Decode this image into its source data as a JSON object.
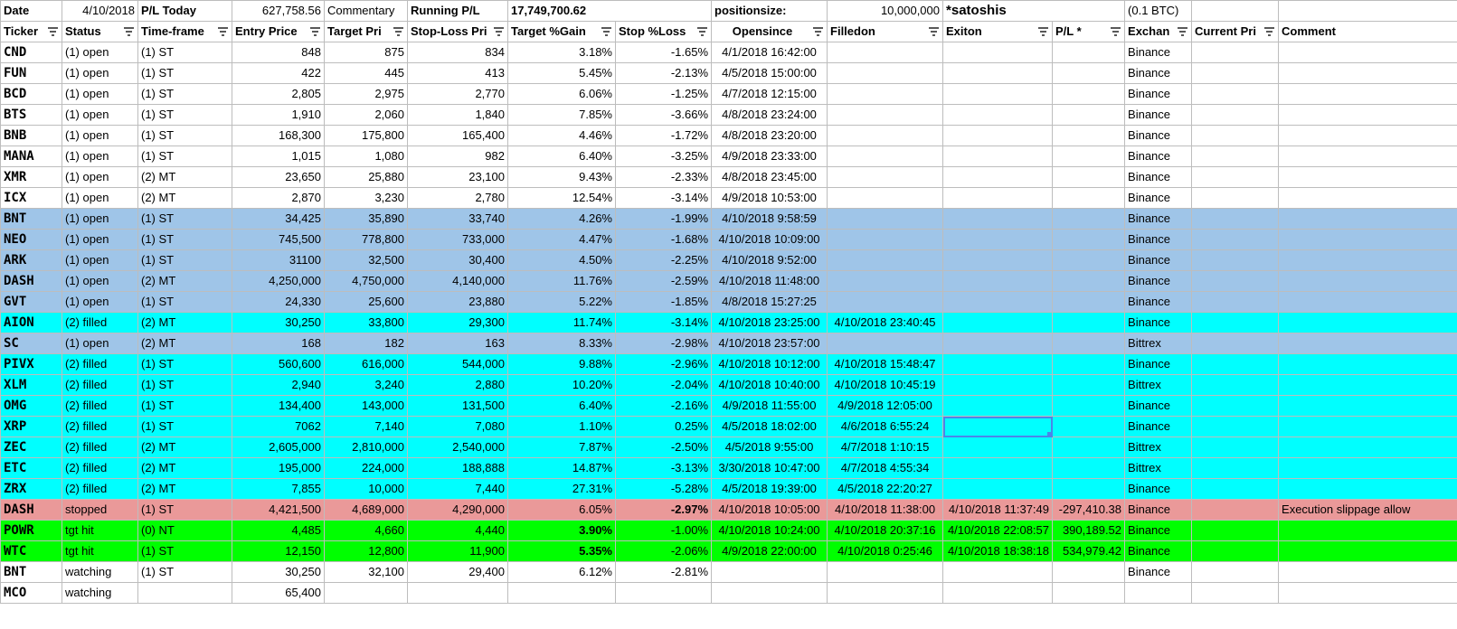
{
  "top_row": {
    "date_label": "Date",
    "date_value": "4/10/2018",
    "pl_today_label": "P/L Today",
    "pl_today_value": "627,758.56",
    "commentary_label": "Commentary",
    "running_pl_label": "Running P/L",
    "running_pl_value": "17,749,700.62",
    "positionsize_label": "positionsize:",
    "positionsize_value": "10,000,000",
    "satoshis_label": "*satoshis",
    "btc_note": "(0.1 BTC)"
  },
  "headers": [
    "Ticker",
    "Status",
    "Time-frame",
    "Entry Price",
    "Target Pri",
    "Stop-Loss Pri",
    "Target %Gain",
    "Stop %Loss",
    "Opensince",
    "Filledon",
    "Exiton",
    "P/L *",
    "Exchan",
    "Current Pri",
    "Comment"
  ],
  "row_colors": {
    "none": "#ffffff",
    "blue": "#9fc5e8",
    "cyan": "#00ffff",
    "red": "#ea9999",
    "green": "#00ff00",
    "selection": "#4a86e8"
  },
  "rows": [
    {
      "color": "none",
      "cells": [
        "CND",
        "(1) open",
        "(1) ST",
        "848",
        "875",
        "834",
        "3.18%",
        "-1.65%",
        "4/1/2018 16:42:00",
        "",
        "",
        "",
        "Binance",
        "",
        ""
      ]
    },
    {
      "color": "none",
      "cells": [
        "FUN",
        "(1) open",
        "(1) ST",
        "422",
        "445",
        "413",
        "5.45%",
        "-2.13%",
        "4/5/2018 15:00:00",
        "",
        "",
        "",
        "Binance",
        "",
        ""
      ]
    },
    {
      "color": "none",
      "cells": [
        "BCD",
        "(1) open",
        "(1) ST",
        "2,805",
        "2,975",
        "2,770",
        "6.06%",
        "-1.25%",
        "4/7/2018 12:15:00",
        "",
        "",
        "",
        "Binance",
        "",
        ""
      ]
    },
    {
      "color": "none",
      "cells": [
        "BTS",
        "(1) open",
        "(1) ST",
        "1,910",
        "2,060",
        "1,840",
        "7.85%",
        "-3.66%",
        "4/8/2018 23:24:00",
        "",
        "",
        "",
        "Binance",
        "",
        ""
      ]
    },
    {
      "color": "none",
      "cells": [
        "BNB",
        "(1) open",
        "(1) ST",
        "168,300",
        "175,800",
        "165,400",
        "4.46%",
        "-1.72%",
        "4/8/2018 23:20:00",
        "",
        "",
        "",
        "Binance",
        "",
        ""
      ]
    },
    {
      "color": "none",
      "cells": [
        "MANA",
        "(1) open",
        "(1) ST",
        "1,015",
        "1,080",
        "982",
        "6.40%",
        "-3.25%",
        "4/9/2018 23:33:00",
        "",
        "",
        "",
        "Binance",
        "",
        ""
      ]
    },
    {
      "color": "none",
      "cells": [
        "XMR",
        "(1) open",
        "(2) MT",
        "23,650",
        "25,880",
        "23,100",
        "9.43%",
        "-2.33%",
        "4/8/2018 23:45:00",
        "",
        "",
        "",
        "Binance",
        "",
        ""
      ]
    },
    {
      "color": "none",
      "cells": [
        "ICX",
        "(1) open",
        "(2) MT",
        "2,870",
        "3,230",
        "2,780",
        "12.54%",
        "-3.14%",
        "4/9/2018 10:53:00",
        "",
        "",
        "",
        "Binance",
        "",
        ""
      ]
    },
    {
      "color": "blue",
      "cells": [
        "BNT",
        "(1) open",
        "(1) ST",
        "34,425",
        "35,890",
        "33,740",
        "4.26%",
        "-1.99%",
        "4/10/2018 9:58:59",
        "",
        "",
        "",
        "Binance",
        "",
        ""
      ]
    },
    {
      "color": "blue",
      "cells": [
        "NEO",
        "(1) open",
        "(1) ST",
        "745,500",
        "778,800",
        "733,000",
        "4.47%",
        "-1.68%",
        "4/10/2018 10:09:00",
        "",
        "",
        "",
        "Binance",
        "",
        ""
      ]
    },
    {
      "color": "blue",
      "cells": [
        "ARK",
        "(1) open",
        "(1) ST",
        "31100",
        "32,500",
        "30,400",
        "4.50%",
        "-2.25%",
        "4/10/2018 9:52:00",
        "",
        "",
        "",
        "Binance",
        "",
        ""
      ]
    },
    {
      "color": "blue",
      "cells": [
        "DASH",
        "(1) open",
        "(2) MT",
        "4,250,000",
        "4,750,000",
        "4,140,000",
        "11.76%",
        "-2.59%",
        "4/10/2018 11:48:00",
        "",
        "",
        "",
        "Binance",
        "",
        ""
      ]
    },
    {
      "color": "blue",
      "cells": [
        "GVT",
        "(1) open",
        "(1) ST",
        "24,330",
        "25,600",
        "23,880",
        "5.22%",
        "-1.85%",
        "4/8/2018 15:27:25",
        "",
        "",
        "",
        "Binance",
        "",
        ""
      ]
    },
    {
      "color": "cyan",
      "cells": [
        "AION",
        "(2) filled",
        "(2) MT",
        "30,250",
        "33,800",
        "29,300",
        "11.74%",
        "-3.14%",
        "4/10/2018 23:25:00",
        "4/10/2018 23:40:45",
        "",
        "",
        "Binance",
        "",
        ""
      ]
    },
    {
      "color": "blue",
      "cells": [
        "SC",
        "(1) open",
        "(2) MT",
        "168",
        "182",
        "163",
        "8.33%",
        "-2.98%",
        "4/10/2018 23:57:00",
        "",
        "",
        "",
        "Bittrex",
        "",
        ""
      ]
    },
    {
      "color": "cyan",
      "cells": [
        "PIVX",
        "(2) filled",
        "(1) ST",
        "560,600",
        "616,000",
        "544,000",
        "9.88%",
        "-2.96%",
        "4/10/2018 10:12:00",
        "4/10/2018 15:48:47",
        "",
        "",
        "Binance",
        "",
        ""
      ]
    },
    {
      "color": "cyan",
      "cells": [
        "XLM",
        "(2) filled",
        "(1) ST",
        "2,940",
        "3,240",
        "2,880",
        "10.20%",
        "-2.04%",
        "4/10/2018 10:40:00",
        "4/10/2018 10:45:19",
        "",
        "",
        "Bittrex",
        "",
        ""
      ]
    },
    {
      "color": "cyan",
      "cells": [
        "OMG",
        "(2) filled",
        "(1) ST",
        "134,400",
        "143,000",
        "131,500",
        "6.40%",
        "-2.16%",
        "4/9/2018 11:55:00",
        "4/9/2018 12:05:00",
        "",
        "",
        "Binance",
        "",
        ""
      ]
    },
    {
      "color": "cyan",
      "cells": [
        "XRP",
        "(2) filled",
        "(1) ST",
        "7062",
        "7,140",
        "7,080",
        "1.10%",
        "0.25%",
        "4/5/2018 18:02:00",
        "4/6/2018 6:55:24",
        "",
        "",
        "Binance",
        "",
        ""
      ]
    },
    {
      "color": "cyan",
      "cells": [
        "ZEC",
        "(2) filled",
        "(2) MT",
        "2,605,000",
        "2,810,000",
        "2,540,000",
        "7.87%",
        "-2.50%",
        "4/5/2018 9:55:00",
        "4/7/2018 1:10:15",
        "",
        "",
        "Bittrex",
        "",
        ""
      ]
    },
    {
      "color": "cyan",
      "cells": [
        "ETC",
        "(2) filled",
        "(2) MT",
        "195,000",
        "224,000",
        "188,888",
        "14.87%",
        "-3.13%",
        "3/30/2018 10:47:00",
        "4/7/2018 4:55:34",
        "",
        "",
        "Bittrex",
        "",
        ""
      ]
    },
    {
      "color": "cyan",
      "cells": [
        "ZRX",
        "(2) filled",
        "(2) MT",
        "7,855",
        "10,000",
        "7,440",
        "27.31%",
        "-5.28%",
        "4/5/2018 19:39:00",
        "4/5/2018 22:20:27",
        "",
        "",
        "Binance",
        "",
        ""
      ]
    },
    {
      "color": "red",
      "cells": [
        "DASH",
        "stopped",
        "(1) ST",
        "4,421,500",
        "4,689,000",
        "4,290,000",
        "6.05%",
        "-2.97%",
        "4/10/2018 10:05:00",
        "4/10/2018 11:38:00",
        "4/10/2018 11:37:49",
        "-297,410.38",
        "Binance",
        "",
        "Execution slippage allow"
      ]
    },
    {
      "color": "green",
      "cells": [
        "POWR",
        "tgt hit",
        "(0) NT",
        "4,485",
        "4,660",
        "4,440",
        "3.90%",
        "-1.00%",
        "4/10/2018 10:24:00",
        "4/10/2018 20:37:16",
        "4/10/2018 22:08:57",
        "390,189.52",
        "Binance",
        "",
        ""
      ]
    },
    {
      "color": "green",
      "cells": [
        "WTC",
        "tgt hit",
        "(1) ST",
        "12,150",
        "12,800",
        "11,900",
        "5.35%",
        "-2.06%",
        "4/9/2018 22:00:00",
        "4/10/2018 0:25:46",
        "4/10/2018 18:38:18",
        "534,979.42",
        "Binance",
        "",
        ""
      ]
    },
    {
      "color": "none",
      "cells": [
        "BNT",
        "watching",
        "(1) ST",
        "30,250",
        "32,100",
        "29,400",
        "6.12%",
        "-2.81%",
        "",
        "",
        "",
        "",
        "Binance",
        "",
        ""
      ]
    },
    {
      "color": "none",
      "cells": [
        "MCO",
        "watching",
        "",
        "65,400",
        "",
        "",
        "",
        "",
        "",
        "",
        "",
        "",
        "",
        "",
        ""
      ]
    }
  ]
}
